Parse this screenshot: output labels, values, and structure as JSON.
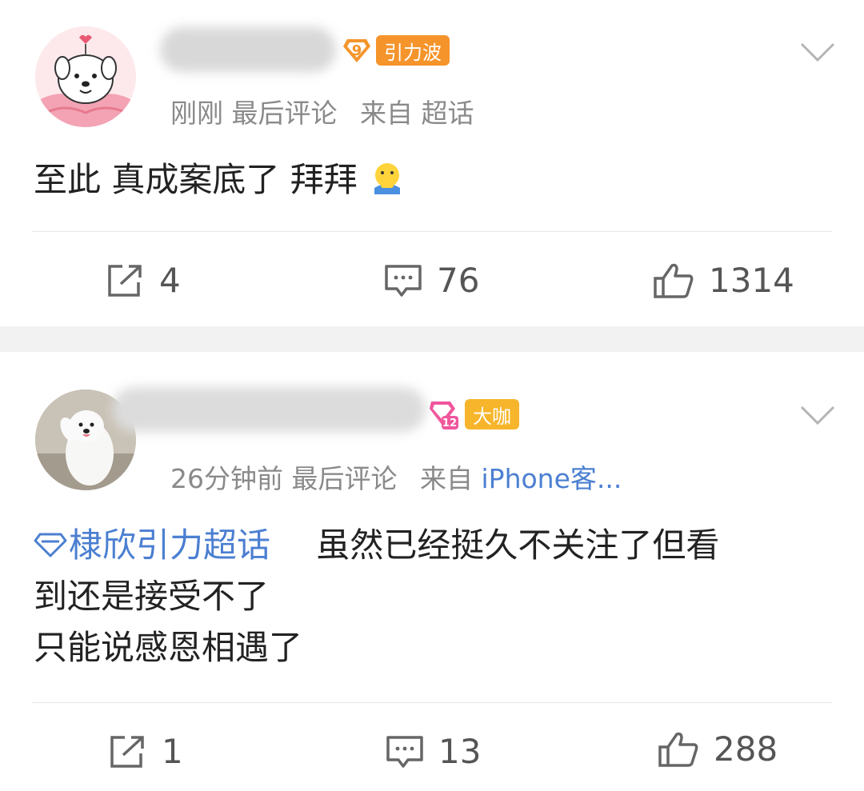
{
  "colors": {
    "link": "#4b7fd1",
    "meta": "#8a8a8a",
    "divider": "#f2f2f2",
    "level_badge": "#f5942b",
    "tag_orange": "#f5942b",
    "tag_yellow": "#f6b52a",
    "level_badge_pink": "#f0569c"
  },
  "posts": [
    {
      "avatar_icon": "cartoon-dog-avatar",
      "level_badge": "9",
      "tag": "引力波",
      "meta": {
        "time": "刚刚",
        "label": "最后评论",
        "source_prefix": "来自",
        "source": "超话"
      },
      "content_line": "至此 真成案底了 拜拜",
      "emoji_icon": "bye-emoji-icon",
      "actions": {
        "repost": "4",
        "comment": "76",
        "like": "1314"
      }
    },
    {
      "avatar_icon": "samoyed-dog-avatar",
      "level_badge": "12",
      "tag": "大咖",
      "meta": {
        "time": "26分钟前",
        "label": "最后评论",
        "source_prefix": "来自",
        "source": "iPhone客..."
      },
      "topic": "棣欣引力超话",
      "content_lines": [
        "虽然已经挺久不关注了但看",
        "到还是接受不了",
        "只能说感恩相遇了"
      ],
      "actions": {
        "repost": "1",
        "comment": "13",
        "like": "288"
      }
    }
  ]
}
